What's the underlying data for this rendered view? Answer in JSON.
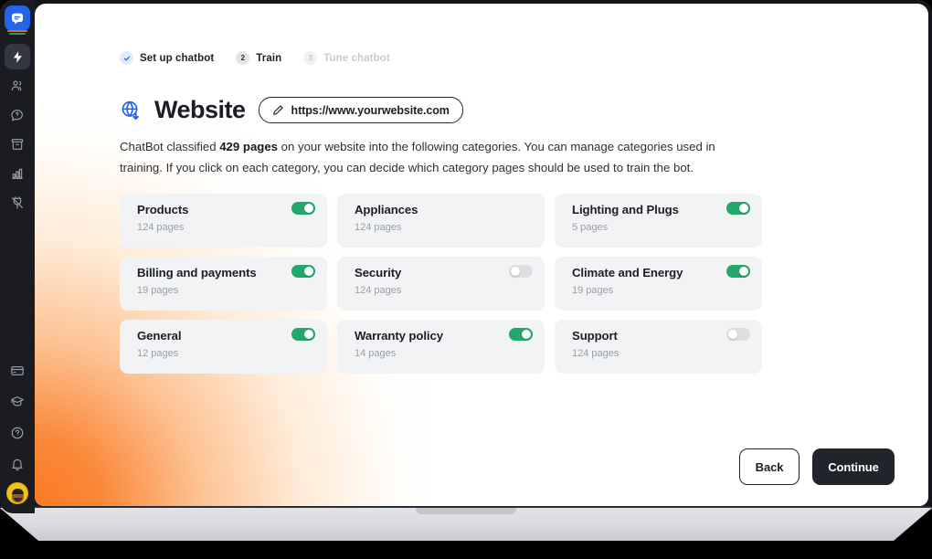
{
  "sidebar": {
    "logo": {
      "name": "chatbot-logo"
    },
    "top_items": [
      {
        "icon": "lightning-bolt-icon",
        "label": "Automations",
        "active": true
      },
      {
        "icon": "users-icon",
        "label": "Users",
        "active": false
      },
      {
        "icon": "chat-question-icon",
        "label": "Chats",
        "active": false
      },
      {
        "icon": "archive-icon",
        "label": "Archives",
        "active": false
      },
      {
        "icon": "bar-chart-icon",
        "label": "Reports",
        "active": false
      },
      {
        "icon": "plug-icon",
        "label": "Integrations",
        "active": false
      }
    ],
    "bottom_items": [
      {
        "icon": "credit-card-icon",
        "label": "Billing"
      },
      {
        "icon": "graduation-cap-icon",
        "label": "Learn"
      },
      {
        "icon": "question-circle-icon",
        "label": "Help"
      },
      {
        "icon": "bell-icon",
        "label": "Notifications"
      }
    ],
    "avatar": {
      "name": "user-avatar",
      "label": "Account"
    }
  },
  "steps": [
    {
      "number": "",
      "label": "Set up chatbot",
      "state": "done",
      "icon": "check-icon"
    },
    {
      "number": "2",
      "label": "Train",
      "state": "current"
    },
    {
      "number": "3",
      "label": "Tune chatbot",
      "state": "todo"
    }
  ],
  "header": {
    "icon": "globe-download-icon",
    "title": "Website",
    "url": "https://www.yourwebsite.com",
    "edit_icon": "pencil-icon"
  },
  "description": {
    "part1": "ChatBot classified ",
    "highlight": "429 pages",
    "part2": " on your website into the following categories. You can manage categories used in training. If you click on each category, you can decide which category pages should be used to train the bot."
  },
  "categories": [
    {
      "title": "Products",
      "pages": "124 pages",
      "toggle": "on"
    },
    {
      "title": "Appliances",
      "pages": "124 pages",
      "toggle": "none"
    },
    {
      "title": "Lighting and Plugs",
      "pages": "5 pages",
      "toggle": "on"
    },
    {
      "title": "Billing and payments",
      "pages": "19 pages",
      "toggle": "on"
    },
    {
      "title": "Security",
      "pages": "124 pages",
      "toggle": "off"
    },
    {
      "title": "Climate and Energy",
      "pages": "19 pages",
      "toggle": "on"
    },
    {
      "title": "General",
      "pages": "12 pages",
      "toggle": "on"
    },
    {
      "title": "Warranty policy",
      "pages": "14 pages",
      "toggle": "on"
    },
    {
      "title": "Support",
      "pages": "124 pages",
      "toggle": "off"
    }
  ],
  "footer": {
    "back_label": "Back",
    "continue_label": "Continue"
  },
  "colors": {
    "accent_blue": "#2563eb",
    "toggle_on": "#22a86a",
    "toggle_off": "#dddfe2",
    "dark": "#21242b",
    "glow_orange": "#f97316",
    "card_bg": "#f2f3f4"
  }
}
